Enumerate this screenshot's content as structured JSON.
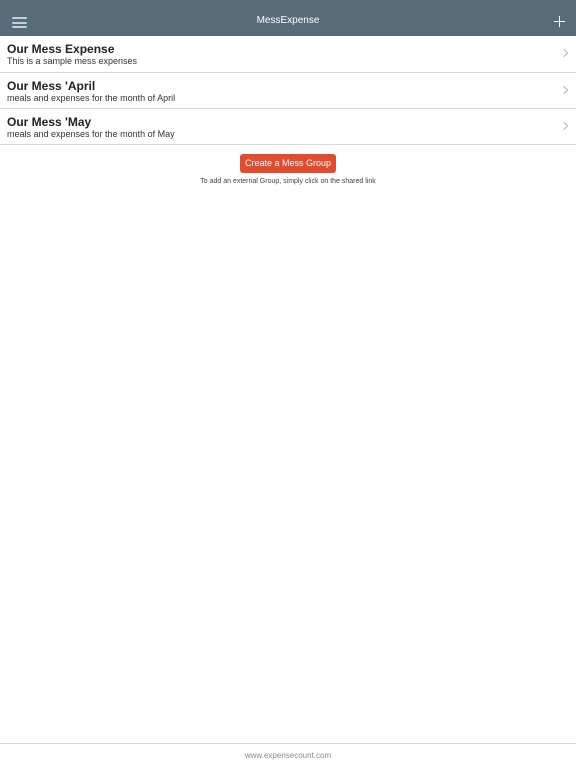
{
  "colors": {
    "navbar_bg": "#566c79",
    "accent": "#e14b2f"
  },
  "navbar": {
    "title": "MessExpense",
    "left_icon": "hamburger-menu-icon",
    "right_icon": "plus-icon"
  },
  "groups": [
    {
      "title": "Our Mess Expense",
      "subtitle": "This is a sample mess expenses"
    },
    {
      "title": "Our Mess 'April",
      "subtitle": "meals and expenses for the month of April"
    },
    {
      "title": "Our Mess 'May",
      "subtitle": "meals and expenses for the month of May"
    }
  ],
  "create_button_label": "Create a Mess Group",
  "hint_text": "To add an external Group, simply click on the shared link",
  "footer_text": "www.expensecount.com"
}
